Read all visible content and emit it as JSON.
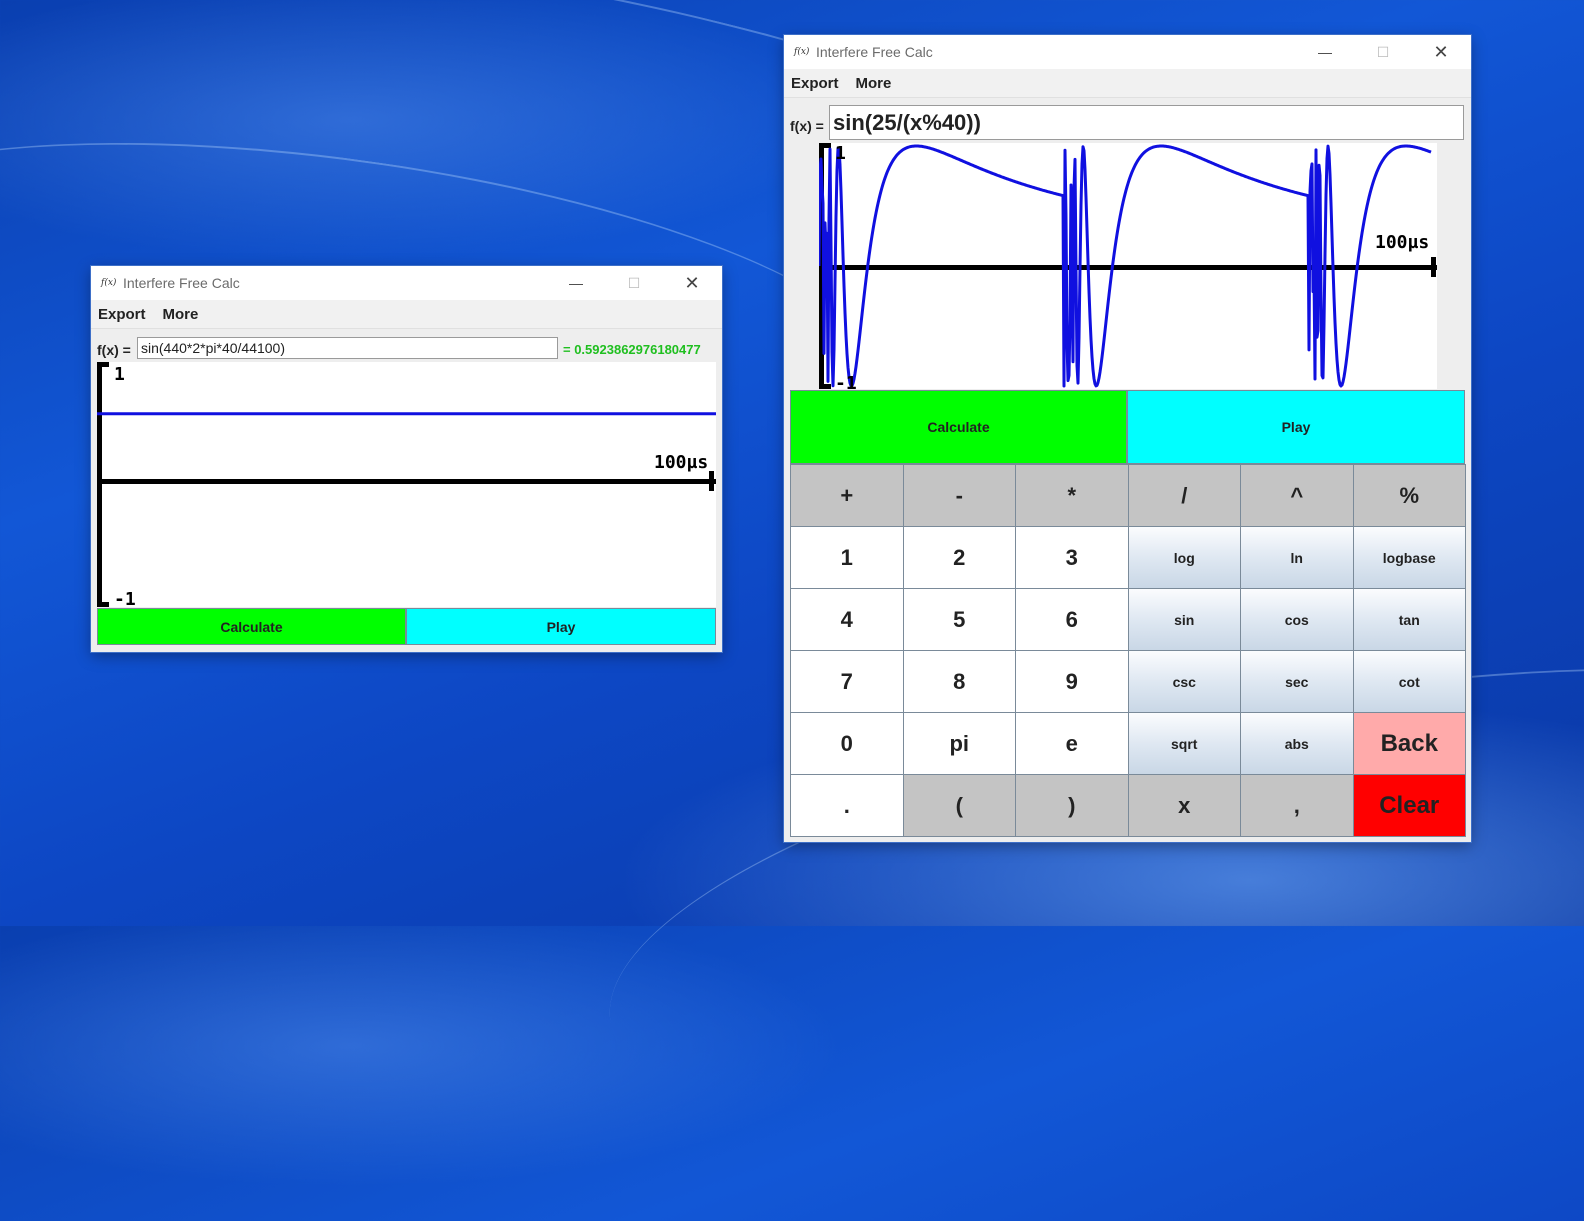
{
  "small_window": {
    "title": "Interfere Free Calc",
    "menus": [
      "Export",
      "More"
    ],
    "fx_label": "f(x) =",
    "expression": "sin(440*2*pi*40/44100)",
    "result": "= 0.5923862976180477",
    "graph": {
      "y_top_label": "1",
      "y_bottom_label": "-1",
      "x_label": "100µs",
      "constant_value": 0.5923862976180477
    },
    "calculate_label": "Calculate",
    "play_label": "Play"
  },
  "large_window": {
    "title": "Interfere Free Calc",
    "menus": [
      "Export",
      "More"
    ],
    "fx_label": "f(x) =",
    "expression": "sin(25/(x%40))",
    "graph": {
      "y_top_label": "1",
      "y_bottom_label": "-1",
      "x_label": "100µs"
    },
    "calculate_label": "Calculate",
    "play_label": "Play",
    "keypad": [
      [
        "+",
        "-",
        "*",
        "/",
        "^",
        "%"
      ],
      [
        "1",
        "2",
        "3",
        "log",
        "ln",
        "logbase"
      ],
      [
        "4",
        "5",
        "6",
        "sin",
        "cos",
        "tan"
      ],
      [
        "7",
        "8",
        "9",
        "csc",
        "sec",
        "cot"
      ],
      [
        "0",
        "pi",
        "e",
        "sqrt",
        "abs",
        "Back"
      ],
      [
        ".",
        "(",
        ")",
        "x",
        ",",
        "Clear"
      ]
    ]
  },
  "colors": {
    "calculate": "#00ff00",
    "play": "#00ffff",
    "back": "#ffaaaa",
    "clear": "#ff0000",
    "result_text": "#1fbf1f",
    "plot_line": "#1010e0"
  }
}
